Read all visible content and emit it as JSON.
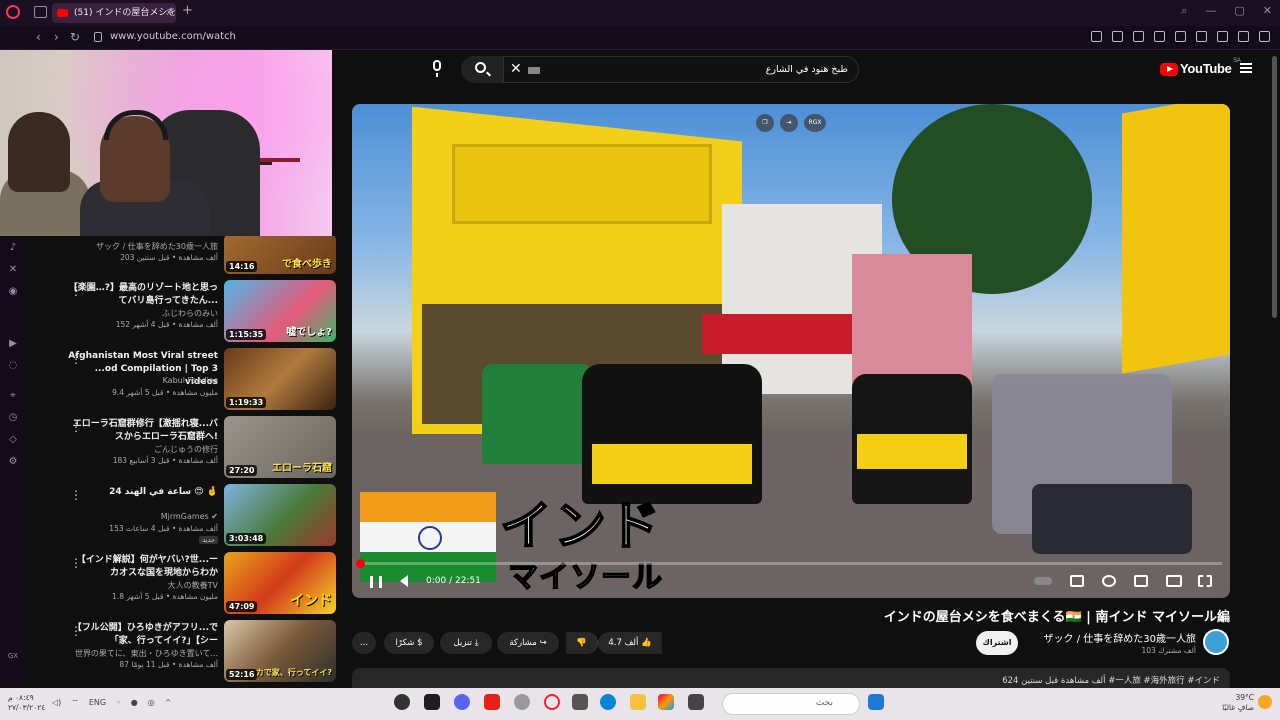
{
  "browser": {
    "tab_title": "(51) インドの屋台メシを食",
    "url": "www.youtube.com/watch",
    "new_tab": "+",
    "close_tab": "x"
  },
  "youtube": {
    "logo_text": "YouTube",
    "region": "SA",
    "search_query": "طبخ هنود في الشارع",
    "video": {
      "title_overlay_1": "インド",
      "title_overlay_2": "マイソール",
      "overlay_badge": "RGX",
      "time": "0:00 / 22:51",
      "progress": 0
    },
    "video_title": "インドの屋台メシを食べまくる🇮🇳 | 南インド マイソール編",
    "channel_name": "ザック / 仕事を辞めた30歳一人旅",
    "subscribers": "103 ألف مشترك",
    "subscribe_label": "اشتراك",
    "likes": "4.7 ألف",
    "share_label": "مشاركة",
    "download_label": "تنزيل",
    "thanks_label": "شكرًا",
    "more_label": "...",
    "description_line": "624 ألف مشاهدة  قبل سنتين  #一人旅 #海外旅行 #インド"
  },
  "related": [
    {
      "title": "",
      "channel": "ザック / 仕事を辞めた30歳一人旅",
      "meta": "203 ألف مشاهدة • قبل سنتين",
      "duration": "14:16",
      "thumb_text": "で食べ歩き"
    },
    {
      "title": "【楽園…?】最高のリゾート地と思ってバリ島行ってきたん...",
      "channel": "ふじわらのみい",
      "meta": "152 ألف مشاهدة • قبل 4 أشهر",
      "duration": "1:15:35",
      "thumb_text": "嘘でしょ?"
    },
    {
      "title": "Afghanistan Most Viral street ...od Compilation | Top 3 videos",
      "channel": "Kabul Foodies",
      "meta": "9.4 مليون مشاهدة • قبل 5 أشهر",
      "duration": "1:19:33",
      "thumb_text": ""
    },
    {
      "title": "エローラ石窟群修行【激揺れ寝...バスからエローラ石窟群へ!",
      "channel": "ごんじゅうの修行",
      "meta": "183 ألف مشاهدة • قبل 3 أسابيع",
      "duration": "27:20",
      "thumb_text": "エローラ石窟"
    },
    {
      "title": "24 ساعة في الهند 😍 🤞",
      "channel": "MjrmGames ✔",
      "meta": "153 ألف مشاهدة • قبل 4 ساعات",
      "duration": "3:03:48",
      "thumb_text": "جديد"
    },
    {
      "title": "【インド解説】何がヤバい?世...ーカオスな国を現地からわか",
      "channel": "大人の教養TV",
      "meta": "1.8 مليون مشاهدة • قبل 5 أشهر",
      "duration": "47:09",
      "thumb_text": "インド"
    },
    {
      "title": "【フル公開】ひろゆきがアフリ...で「家、行ってイイ?」【シー",
      "channel": "世界の果てに、東出・ひろゆき置いて...",
      "meta": "87 ألف مشاهدة • قبل 11 يومًا",
      "duration": "52:16",
      "thumb_text": "カで家、行ってイイ?"
    }
  ],
  "taskbar": {
    "clock_time": "٠٨:٤٩ م",
    "clock_date": "٢٧/٠٣/٢٠٢٤",
    "lang": "ENG",
    "search_placeholder": "بحث",
    "weather_temp": "39°C",
    "weather_desc": "صافٍ غالبًا"
  }
}
